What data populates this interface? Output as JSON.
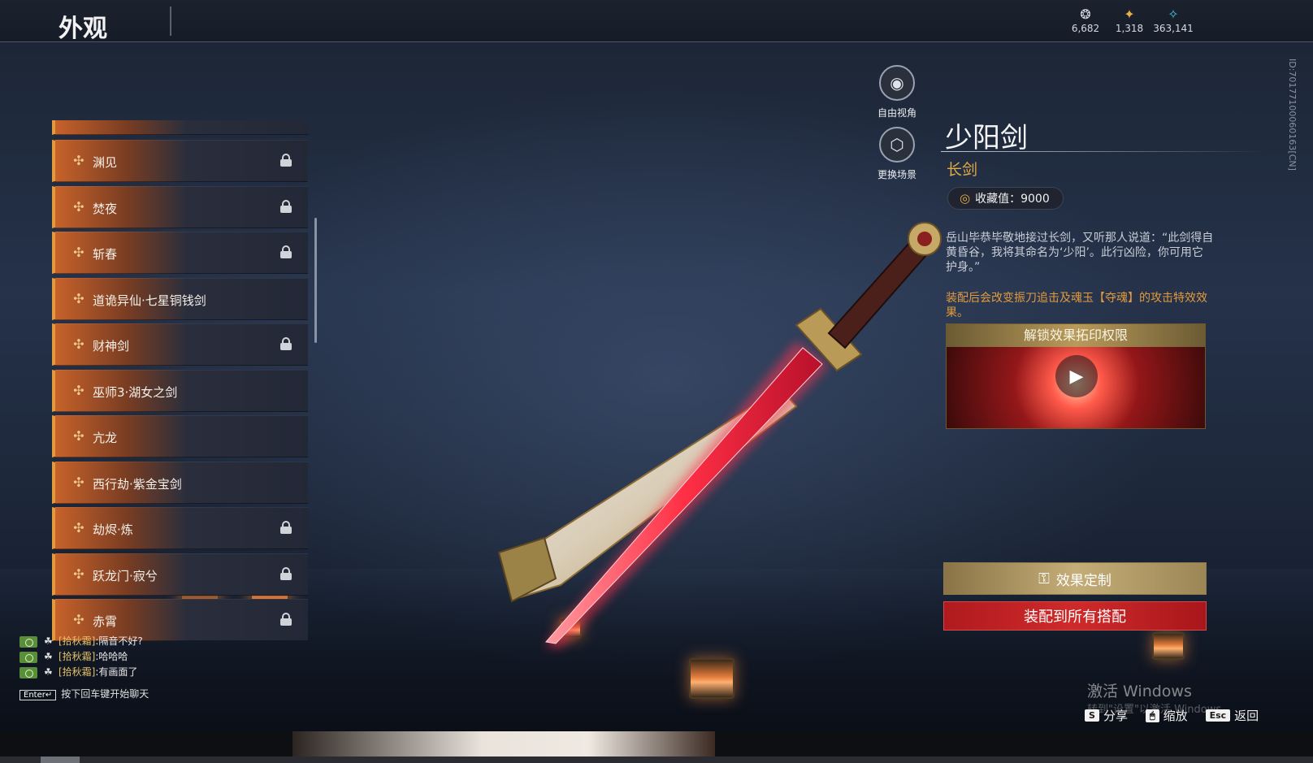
{
  "header": {
    "title": "外观",
    "currencies": [
      {
        "icon": "spirit-currency-icon",
        "glyph": "❂",
        "value": "6,682"
      },
      {
        "icon": "ticket-currency-icon",
        "glyph": "✦",
        "value": "1,318"
      },
      {
        "icon": "feather-currency-icon",
        "glyph": "✧",
        "value": "363,141"
      }
    ]
  },
  "side_id": "ID:70177100060163[CN]",
  "skin_list": {
    "items": [
      {
        "label": "渊见",
        "locked": true
      },
      {
        "label": "焚夜",
        "locked": true
      },
      {
        "label": "斩春",
        "locked": true
      },
      {
        "label": "道诡异仙·七星铜钱剑",
        "locked": false
      },
      {
        "label": "财神剑",
        "locked": true
      },
      {
        "label": "巫师3·湖女之剑",
        "locked": false
      },
      {
        "label": "亢龙",
        "locked": false
      },
      {
        "label": "西行劫·紫金宝剑",
        "locked": false
      },
      {
        "label": "劫烬·炼",
        "locked": true
      },
      {
        "label": "跃龙门·寂兮",
        "locked": true
      },
      {
        "label": "赤霄",
        "locked": true
      }
    ]
  },
  "view_buttons": {
    "free_view": "自由视角",
    "change_scene": "更换场景"
  },
  "detail": {
    "name": "少阳剑",
    "type": "长剑",
    "collect_label": "收藏值：9000",
    "description": "岳山毕恭毕敬地接过长剑，又听那人说道：“此剑得自黄昏谷，我将其命名为‘少阳’。此行凶险，你可用它护身。”",
    "effect_note": "装配后会改变振刀追击及魂玉【夺魂】的攻击特效效果。",
    "unlock_title": "解锁效果拓印权限",
    "customize_button": "效果定制",
    "equip_all_button": "装配到所有搭配"
  },
  "chat": {
    "lines": [
      {
        "name": "[拾秋霜]",
        "text": ":隔音不好?"
      },
      {
        "name": "[拾秋霜]",
        "text": ":哈哈哈"
      },
      {
        "name": "[拾秋霜]",
        "text": ":有画面了"
      }
    ],
    "enter_key": "Enter↵",
    "hint": "按下回车键开始聊天"
  },
  "hints": {
    "share_key": "S",
    "share_label": "分享",
    "zoom_label": "缩放",
    "back_key": "Esc",
    "back_label": "返回"
  },
  "watermark": {
    "line1": "激活 Windows",
    "line2": "转到\"设置\"以激活 Windows。"
  }
}
